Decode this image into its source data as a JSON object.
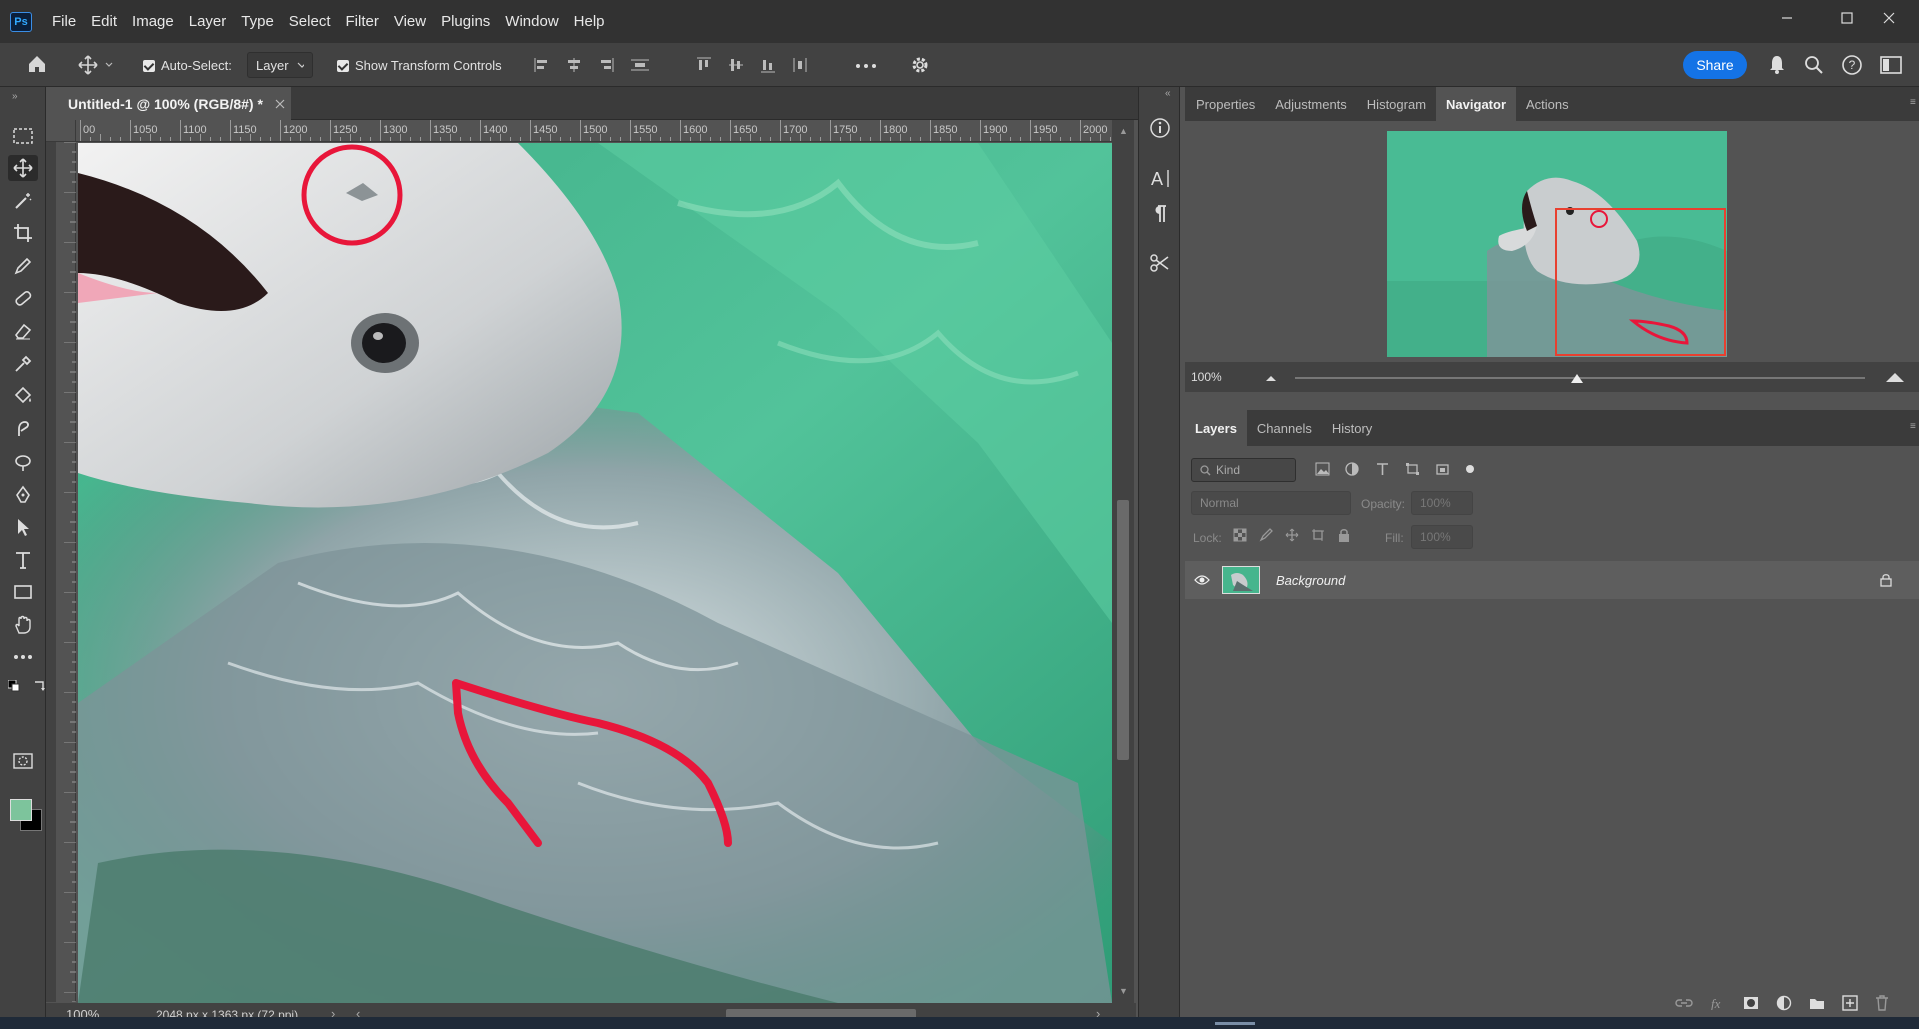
{
  "menubar": {
    "app_logo": "Ps",
    "items": [
      "File",
      "Edit",
      "Image",
      "Layer",
      "Type",
      "Select",
      "Filter",
      "View",
      "Plugins",
      "Window",
      "Help"
    ]
  },
  "options": {
    "auto_select_label": "Auto-Select:",
    "auto_select_value": "Layer",
    "show_transform_label": "Show Transform Controls",
    "share_label": "Share"
  },
  "document": {
    "tab_title": "Untitled-1 @ 100% (RGB/8#) *",
    "ruler_ticks": [
      "00",
      "1050",
      "1100",
      "1150",
      "1200",
      "1250",
      "1300",
      "1350",
      "1400",
      "1450",
      "1500",
      "1550",
      "1600",
      "1650",
      "1700",
      "1750",
      "1800",
      "1850",
      "1900",
      "1950",
      "2000"
    ],
    "zoom": "100%",
    "doc_info": "2048 px x 1363 px (72 ppi)"
  },
  "panels": {
    "top_tabs": [
      "Properties",
      "Adjustments",
      "Histogram",
      "Navigator",
      "Actions"
    ],
    "active_top_tab": "Navigator",
    "navigator_zoom": "100%",
    "bottom_tabs": [
      "Layers",
      "Channels",
      "History"
    ],
    "active_bottom_tab": "Layers",
    "kind_placeholder": "Kind",
    "blend_mode": "Normal",
    "opacity_label": "Opacity:",
    "opacity_value": "100%",
    "lock_label": "Lock:",
    "fill_label": "Fill:",
    "fill_value": "100%",
    "layers": [
      {
        "name": "Background",
        "visible": true,
        "locked": true
      }
    ]
  },
  "colors": {
    "accent": "#1473e6",
    "annotation": "#e8163a",
    "foreground_swatch": "#7dc49c",
    "background_swatch": "#000000"
  }
}
